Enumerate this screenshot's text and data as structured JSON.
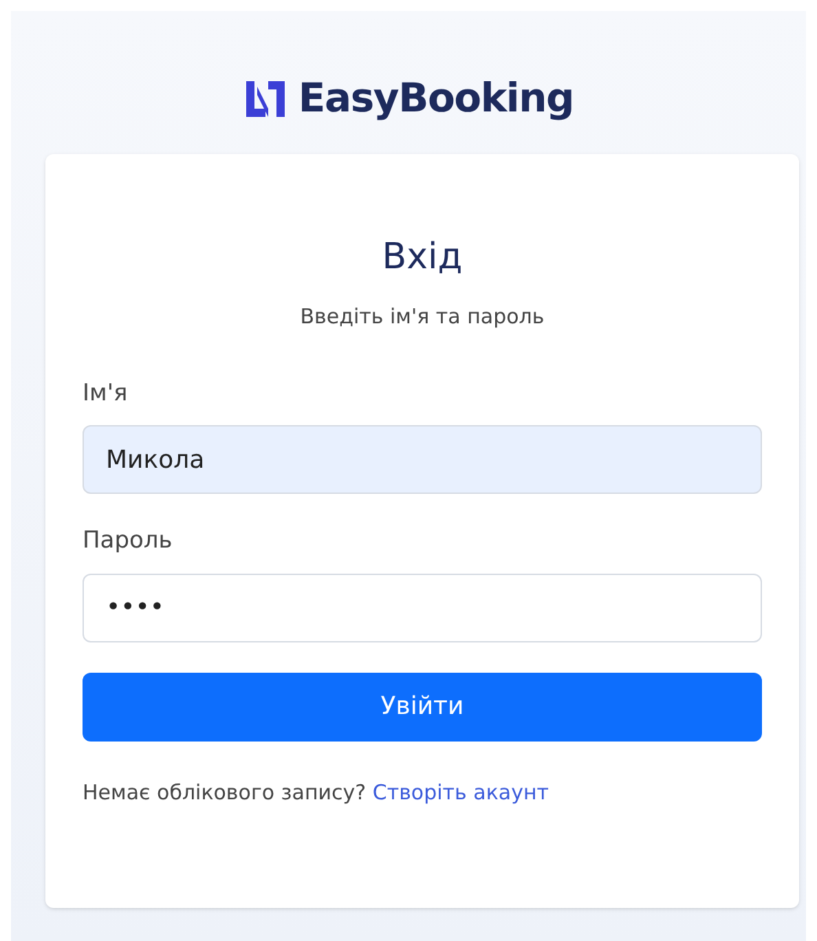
{
  "brand": {
    "name": "EasyBooking"
  },
  "card": {
    "title": "Вхід",
    "subtitle": "Введіть ім'я та пароль"
  },
  "fields": [
    {
      "label": "Ім'я",
      "value": "Микола",
      "autofilled": true
    },
    {
      "label": "Пароль",
      "value": "••••",
      "autofilled": false
    }
  ],
  "submit": {
    "label": "Увійти"
  },
  "footer": {
    "text": "Немає облікового запису?",
    "link": "Створіть акаунт"
  }
}
